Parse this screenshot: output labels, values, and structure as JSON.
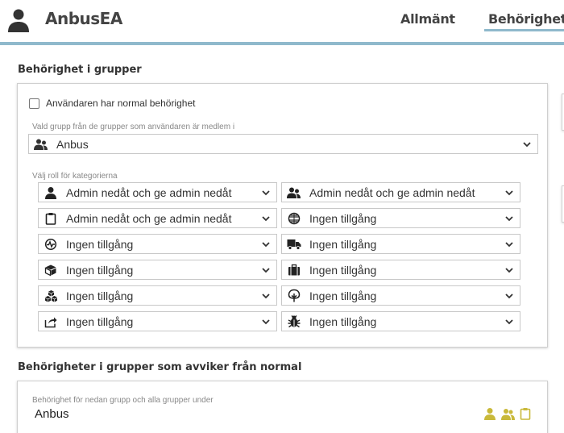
{
  "header": {
    "app_title": "AnbusEA",
    "tabs": [
      {
        "label": "Allmänt",
        "active": false
      },
      {
        "label": "Behörighet",
        "active": true
      }
    ],
    "accent_color": "#8fb9cc"
  },
  "group_permissions": {
    "title": "Behörighet i grupper",
    "normal_permission_checkbox": {
      "label": "Användaren har normal behörighet",
      "checked": false
    },
    "group_select": {
      "label": "Vald grupp från de grupper som användaren är medlem i",
      "value": "Anbus",
      "icon": "users-icon"
    },
    "roles_label": "Välj roll för kategorierna",
    "roles": [
      {
        "icon": "user-icon",
        "value": "Admin nedåt och ge admin nedåt"
      },
      {
        "icon": "users-icon",
        "value": "Admin nedåt och ge admin nedåt"
      },
      {
        "icon": "clipboard-icon",
        "value": "Admin nedåt och ge admin nedåt"
      },
      {
        "icon": "globe-icon",
        "value": "Ingen tillgång"
      },
      {
        "icon": "heartbeat-icon",
        "value": "Ingen tillgång"
      },
      {
        "icon": "truck-icon",
        "value": "Ingen tillgång"
      },
      {
        "icon": "box-icon",
        "value": "Ingen tillgång"
      },
      {
        "icon": "suitcase-icon",
        "value": "Ingen tillgång"
      },
      {
        "icon": "boxes-icon",
        "value": "Ingen tillgång"
      },
      {
        "icon": "tree-icon",
        "value": "Ingen tillgång"
      },
      {
        "icon": "share-icon",
        "value": "Ingen tillgång"
      },
      {
        "icon": "bug-icon",
        "value": "Ingen tillgång"
      }
    ]
  },
  "abnormal_permissions": {
    "title": "Behörigheter i grupper som avviker från normal",
    "item_label": "Behörighet för nedan grupp och alla grupper under",
    "item_value": "Anbus",
    "legend_icons": [
      "user-icon",
      "users-icon",
      "clipboard-icon"
    ],
    "legend_color": "#c9b93a"
  }
}
